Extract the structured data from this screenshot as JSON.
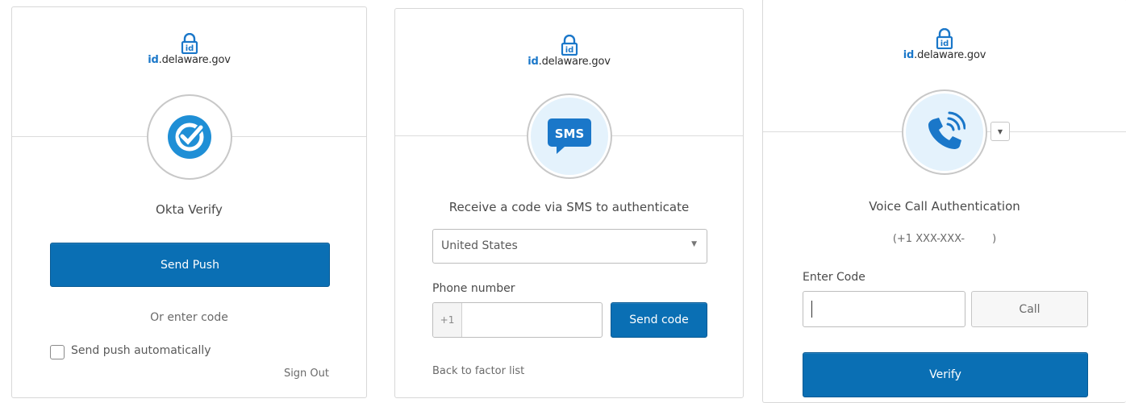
{
  "brand": {
    "id_part": "id",
    "domain_part": ".delaware.gov"
  },
  "okta_verify": {
    "title": "Okta Verify",
    "send_push_label": "Send Push",
    "or_enter_code": "Or enter code",
    "auto_push_label": "Send push automatically",
    "auto_push_checked": false,
    "sign_out_label": "Sign Out"
  },
  "sms": {
    "icon_text": "SMS",
    "title": "Receive a code via SMS to authenticate",
    "country_selected": "United States",
    "phone_label": "Phone number",
    "phone_prefix": "+1",
    "phone_value": "",
    "send_code_label": "Send code",
    "back_label": "Back to factor list"
  },
  "voice": {
    "title": "Voice Call Authentication",
    "phone_masked": "(+1 XXX-XXX-",
    "phone_masked_end": ")",
    "enter_code_label": "Enter Code",
    "code_value": "",
    "call_label": "Call",
    "verify_label": "Verify"
  },
  "colors": {
    "accent": "#0a6fb4",
    "icon_blue": "#1a77c9",
    "icon_bg": "#e4f2fc"
  }
}
